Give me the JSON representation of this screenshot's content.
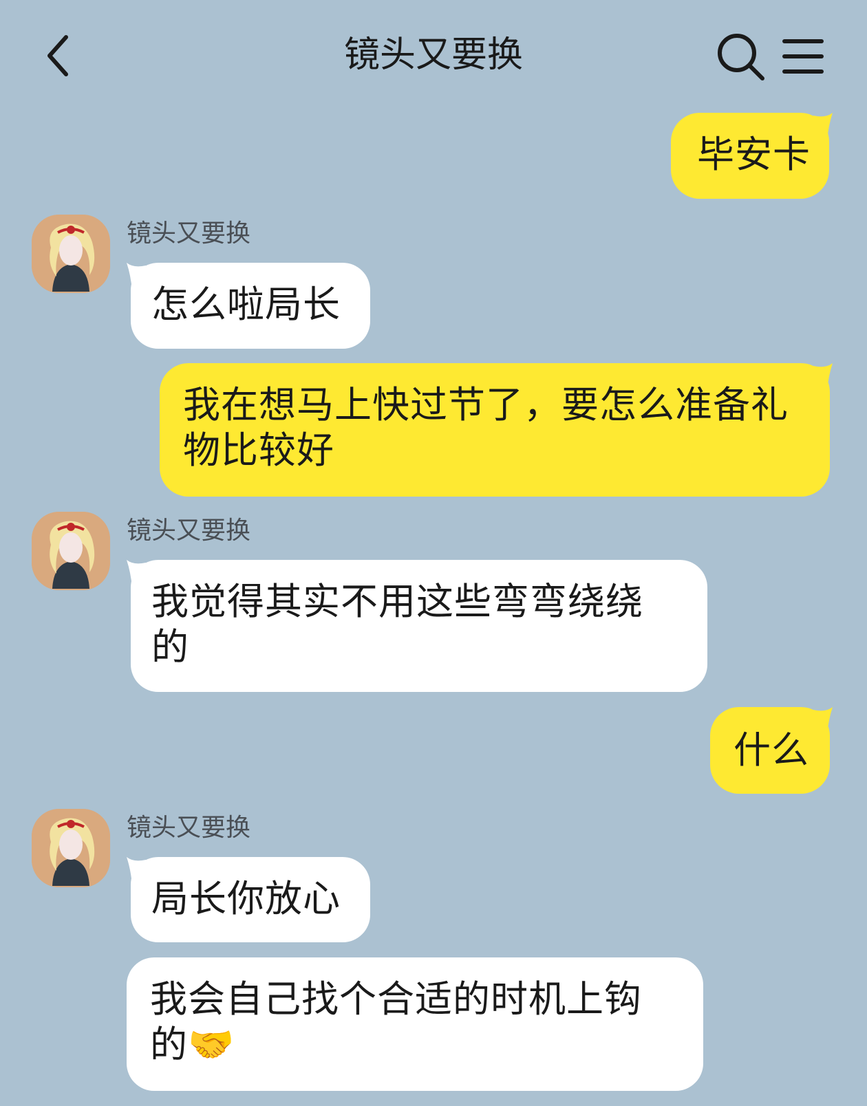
{
  "header": {
    "title": "镜头又要换",
    "back_icon": "chevron-left-icon",
    "search_icon": "search-icon",
    "menu_icon": "hamburger-menu-icon"
  },
  "colors": {
    "background": "#abc1d1",
    "my_bubble": "#fee932",
    "their_bubble": "#ffffff"
  },
  "messages": [
    {
      "from": "me",
      "text": "毕安卡"
    },
    {
      "from": "them",
      "sender": "镜头又要换",
      "text": "怎么啦局长"
    },
    {
      "from": "me",
      "text": "我在想马上快过节了，要怎么准备礼物比较好"
    },
    {
      "from": "them",
      "sender": "镜头又要换",
      "text": "我觉得其实不用这些弯弯绕绕的"
    },
    {
      "from": "me",
      "text": "什么"
    },
    {
      "from": "them",
      "sender": "镜头又要换",
      "text": "局长你放心"
    },
    {
      "from": "them",
      "text": "我会自己找个合适的时机上钩的🤝"
    }
  ]
}
